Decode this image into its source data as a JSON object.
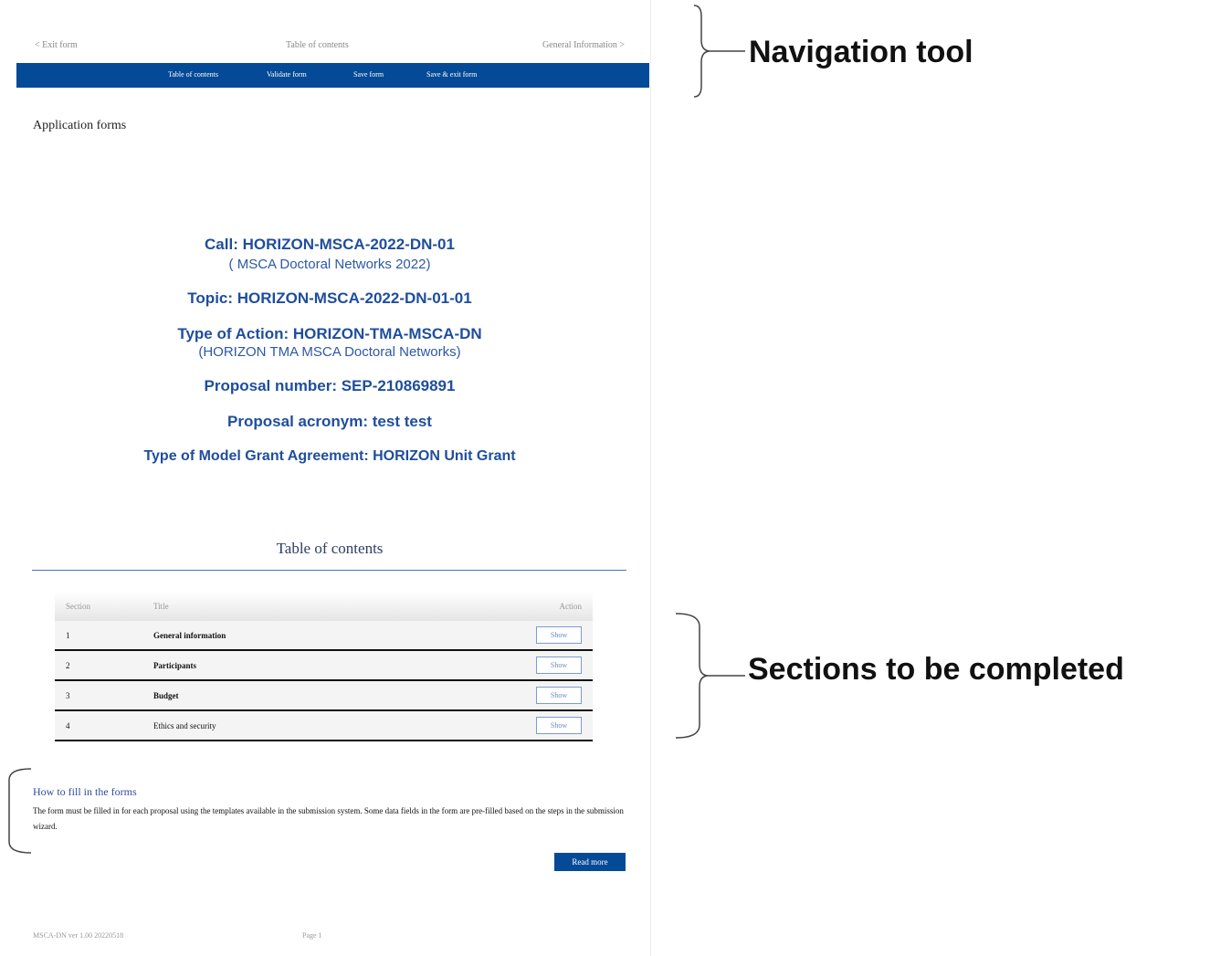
{
  "top_nav": {
    "prev": "< Exit form",
    "current": "Table of contents",
    "next": "General Information >"
  },
  "toolbar": {
    "items": [
      "Table of contents",
      "Validate form",
      "Save form",
      "Save & exit form"
    ]
  },
  "section_heading": "Application forms",
  "call_info": {
    "call": "Call: HORIZON-MSCA-2022-DN-01",
    "call_sub": "( MSCA Doctoral Networks 2022)",
    "topic": "Topic: HORIZON-MSCA-2022-DN-01-01",
    "action_type": "Type of Action: HORIZON-TMA-MSCA-DN",
    "action_sub": "(HORIZON TMA MSCA Doctoral Networks)",
    "proposal_number": "Proposal number: SEP-210869891",
    "proposal_acronym": "Proposal acronym: test test",
    "mga_type": "Type of Model Grant Agreement: HORIZON Unit Grant"
  },
  "toc": {
    "title": "Table of contents",
    "headers": {
      "section": "Section",
      "title": "Title",
      "action": "Action"
    },
    "rows": [
      {
        "section": "1",
        "title": "General information",
        "action": "Show"
      },
      {
        "section": "2",
        "title": "Participants",
        "action": "Show"
      },
      {
        "section": "3",
        "title": "Budget",
        "action": "Show"
      },
      {
        "section": "4",
        "title": "Ethics and security",
        "action": "Show"
      }
    ]
  },
  "howto": {
    "title": "How to fill in the forms",
    "text": "The form must be filled in for each proposal using the templates available in the submission system. Some data fields in the form are pre-filled based on the steps in the submission wizard.",
    "button": "Read more"
  },
  "footer": {
    "version": "MSCA-DN ver 1.00 20220518",
    "page": "Page 1"
  },
  "annotations": {
    "navigation": "Navigation tool",
    "sections": "Sections to be completed"
  }
}
